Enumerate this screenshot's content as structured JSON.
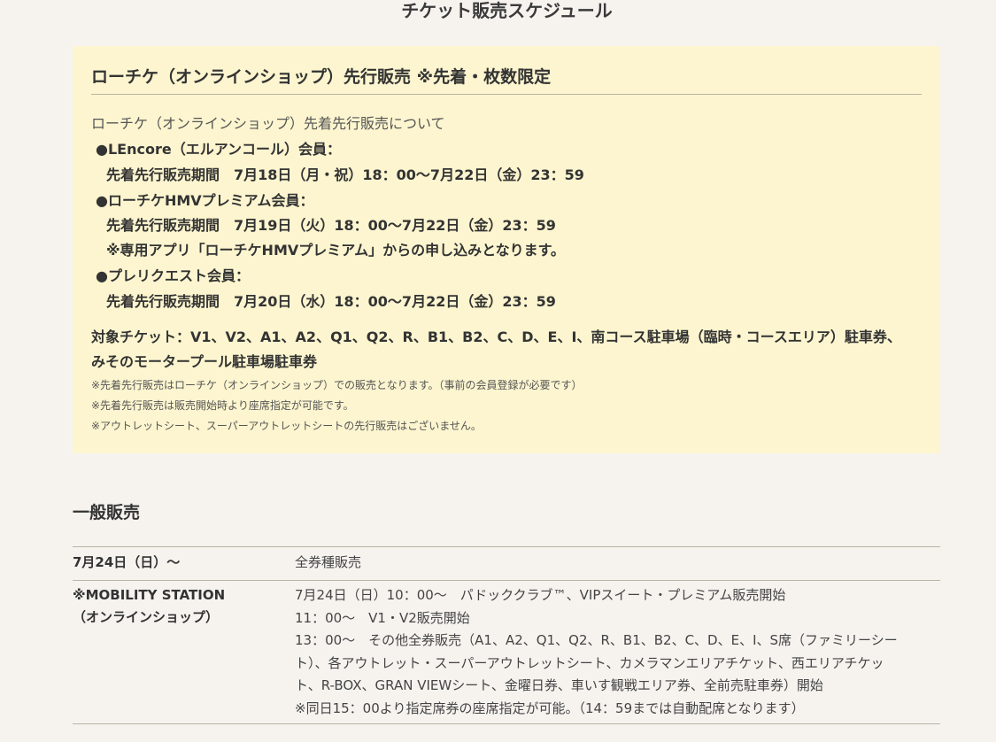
{
  "page_title": "チケット販売スケジュール",
  "presale": {
    "heading": "ローチケ（オンラインショップ）先行販売 ※先着・枚数限定",
    "intro": "ローチケ（オンラインショップ）先着先行販売について",
    "members": [
      {
        "name": "●LEncore（エルアンコール）会員：",
        "period": "先着先行販売期間　7月18日（月・祝）18：00〜7月22日（金）23：59",
        "note": ""
      },
      {
        "name": "●ローチケHMVプレミアム会員：",
        "period": "先着先行販売期間　7月19日（火）18：00〜7月22日（金）23：59",
        "note": "※専用アプリ「ローチケHMVプレミアム」からの申し込みとなります。"
      },
      {
        "name": "●プレリクエスト会員：",
        "period": "先着先行販売期間　7月20日（水）18：00〜7月22日（金）23：59",
        "note": ""
      }
    ],
    "target": "対象チケット：V1、V2、A1、A2、Q1、Q2、R、B1、B2、C、D、E、I、南コース駐車場（臨時・コースエリア）駐車券、みそのモータープール駐車場駐車券",
    "notes": [
      "※先着先行販売はローチケ（オンラインショップ）での販売となります。（事前の会員登録が必要です）",
      "※先着先行販売は販売開始時より座席指定が可能です。",
      "※アウトレットシート、スーパーアウトレットシートの先行販売はございません。"
    ]
  },
  "general": {
    "heading": "一般販売",
    "rows": [
      {
        "label": [
          "7月24日（日）〜"
        ],
        "lines": [
          "全券種販売"
        ]
      },
      {
        "label": [
          "※MOBILITY STATION",
          "（オンラインショップ）"
        ],
        "lines": [
          "7月24日（日）10：00〜　パドッククラブ™、VIPスイート・プレミアム販売開始",
          "11：00〜　V1・V2販売開始",
          "13：00〜　その他全券販売（A1、A2、Q1、Q2、R、B1、B2、C、D、E、I、S席（ファミリーシー",
          "ト）、各アウトレット・スーパーアウトレットシート、カメラマンエリアチケット、西エリアチケッ",
          "ト、R-BOX、GRAN VIEWシート、金曜日券、車いす観戦エリア券、全前売駐車券）開始",
          "※同日15：00より指定席券の座席指定が可能。（14：59までは自動配席となります）"
        ]
      }
    ]
  }
}
